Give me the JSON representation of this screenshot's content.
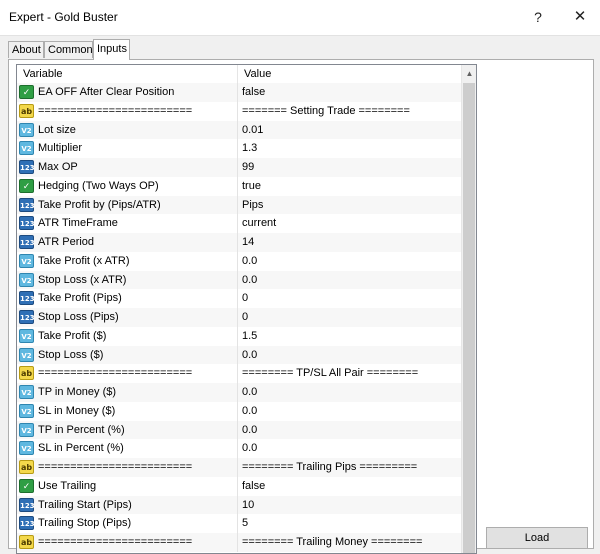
{
  "window": {
    "title": "Expert - Gold Buster",
    "help": "?",
    "close": "✕"
  },
  "tabs": [
    {
      "label": "About"
    },
    {
      "label": "Common"
    },
    {
      "label": "Inputs",
      "active": true
    }
  ],
  "grid": {
    "headers": {
      "variable": "Variable",
      "value": "Value"
    },
    "rows": [
      {
        "type": "bool",
        "name": "EA OFF After Clear Position",
        "value": "false"
      },
      {
        "type": "str",
        "name": "========================",
        "value": "======= Setting Trade ========"
      },
      {
        "type": "dbl",
        "name": "Lot size",
        "value": "0.01"
      },
      {
        "type": "dbl",
        "name": "Multiplier",
        "value": "1.3"
      },
      {
        "type": "int",
        "name": "Max OP",
        "value": "99"
      },
      {
        "type": "bool",
        "name": "Hedging (Two Ways OP)",
        "value": "true"
      },
      {
        "type": "int",
        "name": "Take Profit by (Pips/ATR)",
        "value": "Pips"
      },
      {
        "type": "int",
        "name": "ATR TimeFrame",
        "value": "current"
      },
      {
        "type": "int",
        "name": "ATR Period",
        "value": "14"
      },
      {
        "type": "dbl",
        "name": "Take Profit (x ATR)",
        "value": "0.0"
      },
      {
        "type": "dbl",
        "name": "Stop Loss (x ATR)",
        "value": "0.0"
      },
      {
        "type": "int",
        "name": "Take Profit (Pips)",
        "value": "0"
      },
      {
        "type": "int",
        "name": "Stop Loss (Pips)",
        "value": "0"
      },
      {
        "type": "dbl",
        "name": "Take Profit ($)",
        "value": "1.5"
      },
      {
        "type": "dbl",
        "name": "Stop Loss ($)",
        "value": "0.0"
      },
      {
        "type": "str",
        "name": "========================",
        "value": "======== TP/SL All Pair ========"
      },
      {
        "type": "dbl",
        "name": "TP in Money ($)",
        "value": "0.0"
      },
      {
        "type": "dbl",
        "name": "SL in Money ($)",
        "value": "0.0"
      },
      {
        "type": "dbl",
        "name": "TP in Percent (%)",
        "value": "0.0"
      },
      {
        "type": "dbl",
        "name": "SL in Percent (%)",
        "value": "0.0"
      },
      {
        "type": "str",
        "name": "========================",
        "value": "======== Trailing Pips ========="
      },
      {
        "type": "bool",
        "name": "Use Trailing",
        "value": "false"
      },
      {
        "type": "int",
        "name": "Trailing Start (Pips)",
        "value": "10"
      },
      {
        "type": "int",
        "name": "Trailing Stop (Pips)",
        "value": "5"
      },
      {
        "type": "str",
        "name": "========================",
        "value": "======== Trailing Money ========"
      }
    ]
  },
  "icons": {
    "bool": "check-icon",
    "str": "ab-icon",
    "int": "int-123-icon",
    "dbl": "double-v2-icon"
  },
  "icon_glyphs": {
    "bool": "✓",
    "str": "ab",
    "int": "123",
    "dbl": "V2"
  },
  "buttons": {
    "load": "Load"
  },
  "colors": {
    "bool_icon": "#2f9e44",
    "string_icon": "#f3d84b",
    "integer_icon": "#2f6fb5",
    "double_icon": "#5fb8e0"
  }
}
